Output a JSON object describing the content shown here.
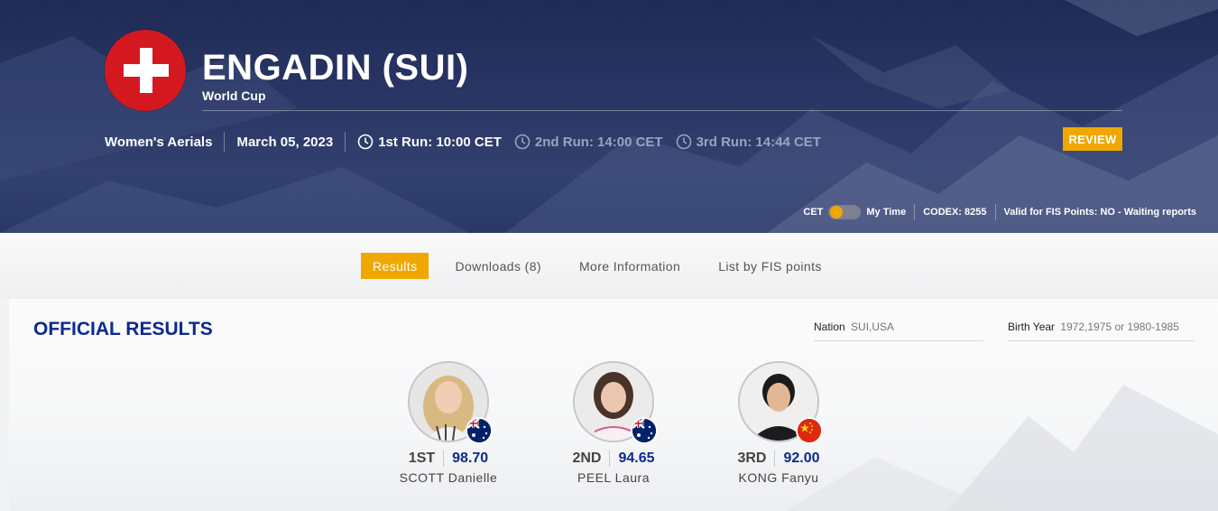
{
  "event": {
    "title": "ENGADIN (SUI)",
    "subtitle": "World Cup",
    "discipline": "Women's Aerials",
    "date": "March 05, 2023",
    "runs": [
      {
        "label": "1st Run: 10:00 CET",
        "active": true
      },
      {
        "label": "2nd Run: 14:00 CET",
        "active": false
      },
      {
        "label": "3rd Run: 14:44 CET",
        "active": false
      }
    ],
    "status_badge": "REVIEW",
    "flag_icon": "swiss-flag-icon"
  },
  "meta": {
    "tz_left": "CET",
    "tz_right": "My Time",
    "codex": "CODEX: 8255",
    "fis_points": "Valid for FIS Points: NO - Waiting reports"
  },
  "tabs": [
    {
      "label": "Results",
      "active": true
    },
    {
      "label": "Downloads (8)",
      "active": false
    },
    {
      "label": "More Information",
      "active": false
    },
    {
      "label": "List by FIS points",
      "active": false
    }
  ],
  "results": {
    "title": "OFFICIAL RESULTS",
    "filters": {
      "nation_label": "Nation",
      "nation_value": "SUI,USA",
      "birth_label": "Birth Year",
      "birth_value": "1972,1975 or 1980-1985"
    },
    "podium": [
      {
        "rank": "1ST",
        "score": "98.70",
        "name": "SCOTT Danielle",
        "nation_flag": "australia-flag-icon"
      },
      {
        "rank": "2ND",
        "score": "94.65",
        "name": "PEEL Laura",
        "nation_flag": "australia-flag-icon"
      },
      {
        "rank": "3RD",
        "score": "92.00",
        "name": "KONG Fanyu",
        "nation_flag": "china-flag-icon"
      }
    ]
  },
  "colors": {
    "accent": "#f0a800",
    "hero_bg": "#2a3766",
    "title_blue": "#0c2a8c",
    "swiss_red": "#d41820"
  }
}
